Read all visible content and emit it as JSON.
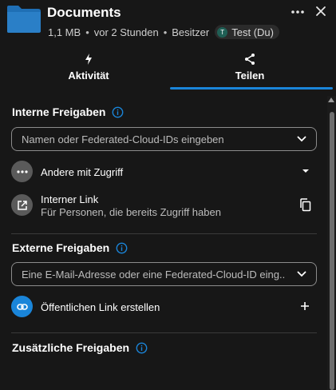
{
  "header": {
    "title": "Documents",
    "size": "1,1 MB",
    "modified": "vor 2 Stunden",
    "owner_label": "Besitzer",
    "owner_initial": "T",
    "owner_name": "Test (Du)"
  },
  "tabs": [
    {
      "label": "Aktivität",
      "icon": "lightning-icon",
      "active": false
    },
    {
      "label": "Teilen",
      "icon": "share-icon",
      "active": true
    }
  ],
  "internal": {
    "title": "Interne Freigaben",
    "search_placeholder": "Namen oder Federated-Cloud-IDs eingeben",
    "others_label": "Andere mit Zugriff",
    "link_title": "Interner Link",
    "link_subtitle": "Für Personen, die bereits Zugriff haben"
  },
  "external": {
    "title": "Externe Freigaben",
    "search_placeholder": "Eine E-Mail-Adresse oder eine Federated-Cloud-ID eing...",
    "public_link_label": "Öffentlichen Link erstellen"
  },
  "additional": {
    "title": "Zusätzliche Freigaben"
  },
  "colors": {
    "accent": "#1a85d9",
    "folder": "#1f6fb5",
    "background": "#171717"
  }
}
